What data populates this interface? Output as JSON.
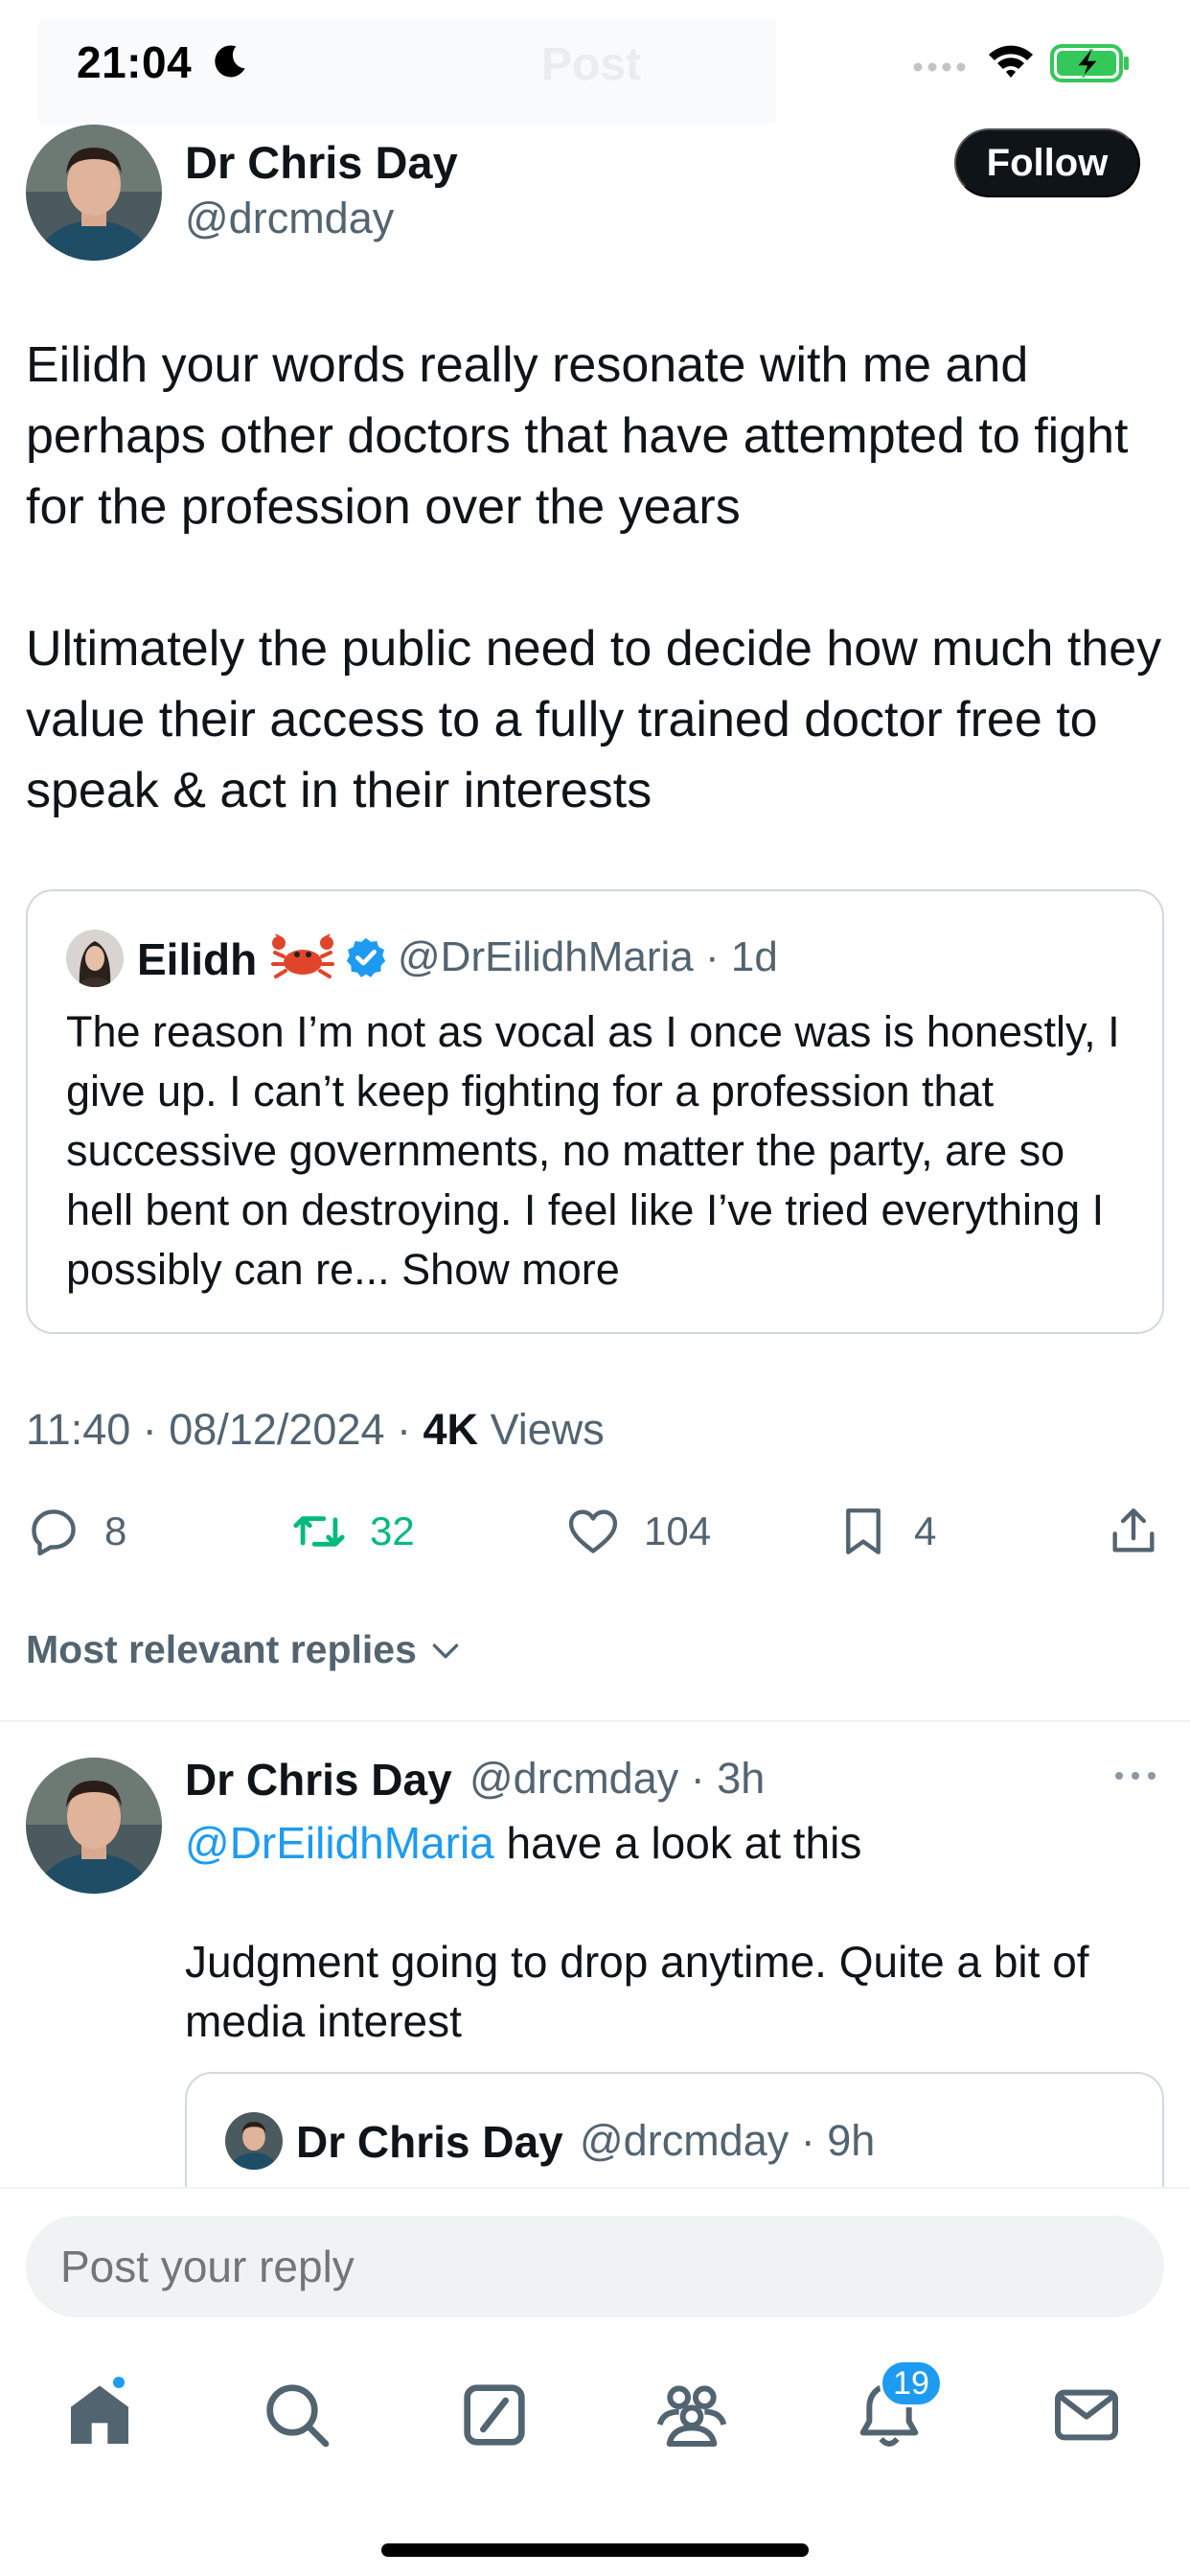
{
  "status_bar": {
    "time": "21:04"
  },
  "nav": {
    "title": "Post"
  },
  "post": {
    "author_name": "Dr Chris Day",
    "author_handle": "@drcmday",
    "follow_label": "Follow",
    "paragraphs": [
      "Eilidh your words really resonate with me and perhaps other doctors that have attempted to fight for the profession over the years",
      "Ultimately the public need to decide how much they value their access to a fully trained doctor free to speak & act in their interests"
    ],
    "quoted": {
      "name": "Eilidh",
      "handle": "@DrEilidhMaria",
      "age": "1d",
      "text": "The reason I’m not as vocal as I once was is honestly, I give up. I can’t keep fighting for a profession that successive governments, no matter the party, are so hell bent on destroying. I feel like I’ve tried everything I possibly can re...",
      "show_more": "Show more"
    },
    "time": "11:40",
    "date": "08/12/2024",
    "views_count": "4K",
    "views_label": "Views",
    "stats": {
      "replies": "8",
      "reposts": "32",
      "likes": "104",
      "bookmarks": "4"
    }
  },
  "replies_sort_label": "Most relevant replies",
  "reply": {
    "author_name": "Dr Chris Day",
    "author_handle": "@drcmday",
    "age": "3h",
    "mention": "@DrEilidhMaria",
    "line1_rest": "have a look at this",
    "paragraph2": "Judgment going to drop anytime. Quite a bit of media interest",
    "quoted": {
      "name": "Dr Chris Day",
      "handle": "@drcmday",
      "age": "9h"
    }
  },
  "composer": {
    "placeholder": "Post your reply"
  },
  "tabbar": {
    "notifications_badge": "19"
  },
  "colors": {
    "accent": "#1d9bf0",
    "repost_green": "#00ba7c",
    "text_primary": "#0f1419",
    "text_secondary": "#536471"
  }
}
